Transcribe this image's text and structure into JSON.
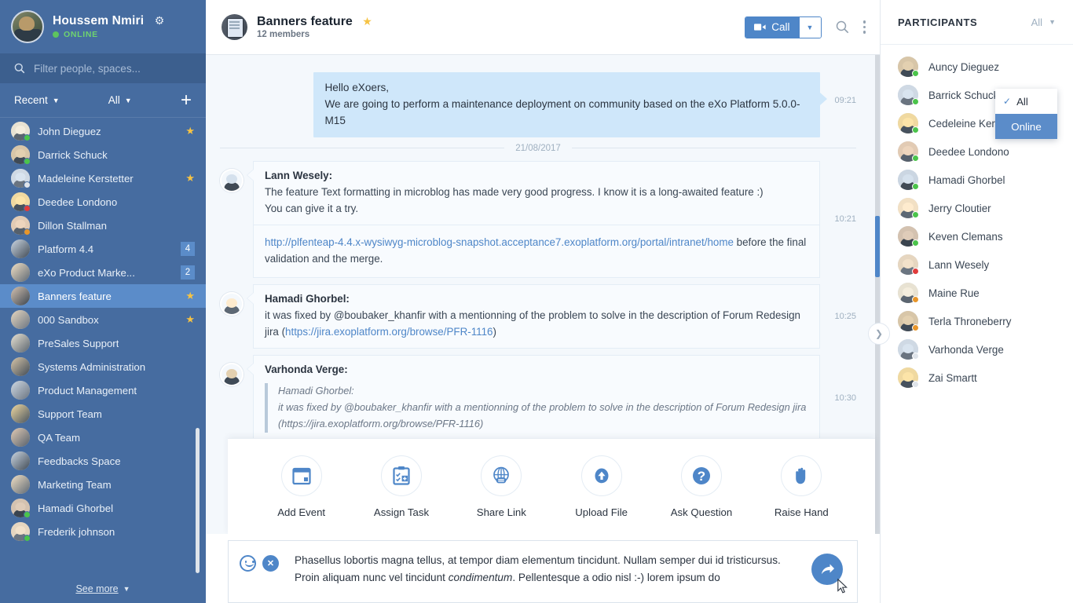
{
  "sidebar": {
    "user": {
      "name": "Houssem Nmiri",
      "status": "ONLINE",
      "gear": "gear-icon"
    },
    "search_placeholder": "Filter people, spaces...",
    "filters": {
      "sort": "Recent",
      "scope": "All",
      "add": "+"
    },
    "items": [
      {
        "label": "John Dieguez",
        "type": "person",
        "presence": "online",
        "star": true
      },
      {
        "label": "Darrick Schuck",
        "type": "person",
        "presence": "online",
        "star": false
      },
      {
        "label": "Madeleine Kerstetter",
        "type": "person",
        "presence": "offline",
        "star": true
      },
      {
        "label": "Deedee Londono",
        "type": "person",
        "presence": "dnd",
        "star": false
      },
      {
        "label": "Dillon Stallman",
        "type": "person",
        "presence": "away",
        "star": false
      },
      {
        "label": "Platform 4.4",
        "type": "space",
        "badge": "4"
      },
      {
        "label": "eXo Product Marke...",
        "type": "space",
        "badge": "2"
      },
      {
        "label": "Banners feature",
        "type": "space",
        "star": true,
        "active": true
      },
      {
        "label": "000 Sandbox",
        "type": "space",
        "star": true
      },
      {
        "label": "PreSales Support",
        "type": "space"
      },
      {
        "label": "Systems Administration",
        "type": "space"
      },
      {
        "label": "Product Management",
        "type": "space"
      },
      {
        "label": "Support Team",
        "type": "space"
      },
      {
        "label": "QA Team",
        "type": "space"
      },
      {
        "label": "Feedbacks Space",
        "type": "space"
      },
      {
        "label": "Marketing Team",
        "type": "space"
      },
      {
        "label": "Hamadi Ghorbel",
        "type": "person",
        "presence": "online"
      },
      {
        "label": "Frederik johnson",
        "type": "person",
        "presence": "online"
      }
    ],
    "see_more": "See more"
  },
  "topbar": {
    "room_title": "Banners feature",
    "room_members": "12 members",
    "star": "star-icon",
    "call_label": "Call",
    "search": "search-icon",
    "more": "kebab-icon"
  },
  "chat": {
    "messages": [
      {
        "kind": "outgoing",
        "time": "09:21",
        "lines": [
          "Hello eXoers,",
          "We are going to perform a maintenance deployment on community based on the eXo Platform 5.0.0-M15"
        ]
      },
      {
        "kind": "date",
        "label": "21/08/2017"
      },
      {
        "kind": "incoming",
        "author": "Lann Wesely:",
        "time": "10:21",
        "lines": [
          "The feature Text formatting in microblog has made very good progress. I know it is a long-awaited feature :)",
          "You can give it a try."
        ],
        "follow_up": {
          "link": "http://plfenteap-4.4.x-wysiwyg-microblog-snapshot.acceptance7.exoplatform.org/portal/intranet/home",
          "tail": " before the final validation and the merge."
        }
      },
      {
        "kind": "incoming",
        "author": "Hamadi Ghorbel:",
        "time": "10:25",
        "text_before": "it was fixed by @boubaker_khanfir with a mentionning of the problem to solve in the description of Forum Redesign jira (",
        "link": "https://jira.exoplatform.org/browse/PFR-1116",
        "text_after": ")"
      },
      {
        "kind": "incoming-quote",
        "author": "Varhonda Verge:",
        "time": "10:30",
        "quote_author": "Hamadi Ghorbel:",
        "quote_line1": "it was fixed by @boubaker_khanfir with a mentionning of the problem to solve in the description of Forum Redesign jira",
        "quote_line2": "(https://jira.exoplatform.org/browse/PFR-1116)"
      }
    ]
  },
  "actionbar": {
    "actions": [
      {
        "label": "Add Event",
        "icon": "calendar-icon"
      },
      {
        "label": "Assign Task",
        "icon": "clipboard-task-icon"
      },
      {
        "label": "Share Link",
        "icon": "globe-link-icon"
      },
      {
        "label": "Upload File",
        "icon": "upload-cloud-icon"
      },
      {
        "label": "Ask Question",
        "icon": "question-mark-icon"
      },
      {
        "label": "Raise Hand",
        "icon": "hand-icon"
      }
    ]
  },
  "composer": {
    "emoji_icon": "emoji-smiley-icon",
    "close_icon": "close-circle-icon",
    "send_icon": "send-arrow-icon",
    "value_part1": "Phasellus lobortis magna tellus, at tempor diam elementum tincidunt. Nullam semper dui id tristicursus. Proin aliquam nunc vel tincidunt ",
    "value_italic": "condimentum",
    "value_part2": ". Pellentesque a odio nisl :-) lorem ipsum do"
  },
  "participants": {
    "title": "PARTICIPANTS",
    "filter_value": "All",
    "dropdown": {
      "open": true,
      "options": [
        "All",
        "Online"
      ],
      "checked": "All",
      "highlighted": "Online"
    },
    "list": [
      {
        "name": "Auncy Dieguez",
        "presence": "online"
      },
      {
        "name": "Barrick Schuck",
        "presence": "online"
      },
      {
        "name": "Cedeleine Kerstetter",
        "presence": "online"
      },
      {
        "name": "Deedee Londono",
        "presence": "online"
      },
      {
        "name": "Hamadi Ghorbel",
        "presence": "online"
      },
      {
        "name": "Jerry Cloutier",
        "presence": "online"
      },
      {
        "name": "Keven Clemans",
        "presence": "online"
      },
      {
        "name": "Lann Wesely",
        "presence": "dnd"
      },
      {
        "name": "Maine Rue",
        "presence": "away"
      },
      {
        "name": "Terla Throneberry",
        "presence": "away"
      },
      {
        "name": "Varhonda Verge",
        "presence": "offline"
      },
      {
        "name": "Zai Smartt",
        "presence": "offline"
      }
    ],
    "collapse_icon": "chevron-right-icon"
  },
  "colors": {
    "sidebar_bg": "#466ca0",
    "sidebar_active": "#5b8cc9",
    "accent": "#4e86c8",
    "bubble_out": "#cfe7fa",
    "bubble_in": "#f8fbfe",
    "chat_bg": "#f4f8fc",
    "star": "#f6c344",
    "online": "#4bc44b",
    "dnd": "#e03b3b",
    "away": "#e8962a",
    "offline": "#dfe4ea"
  }
}
